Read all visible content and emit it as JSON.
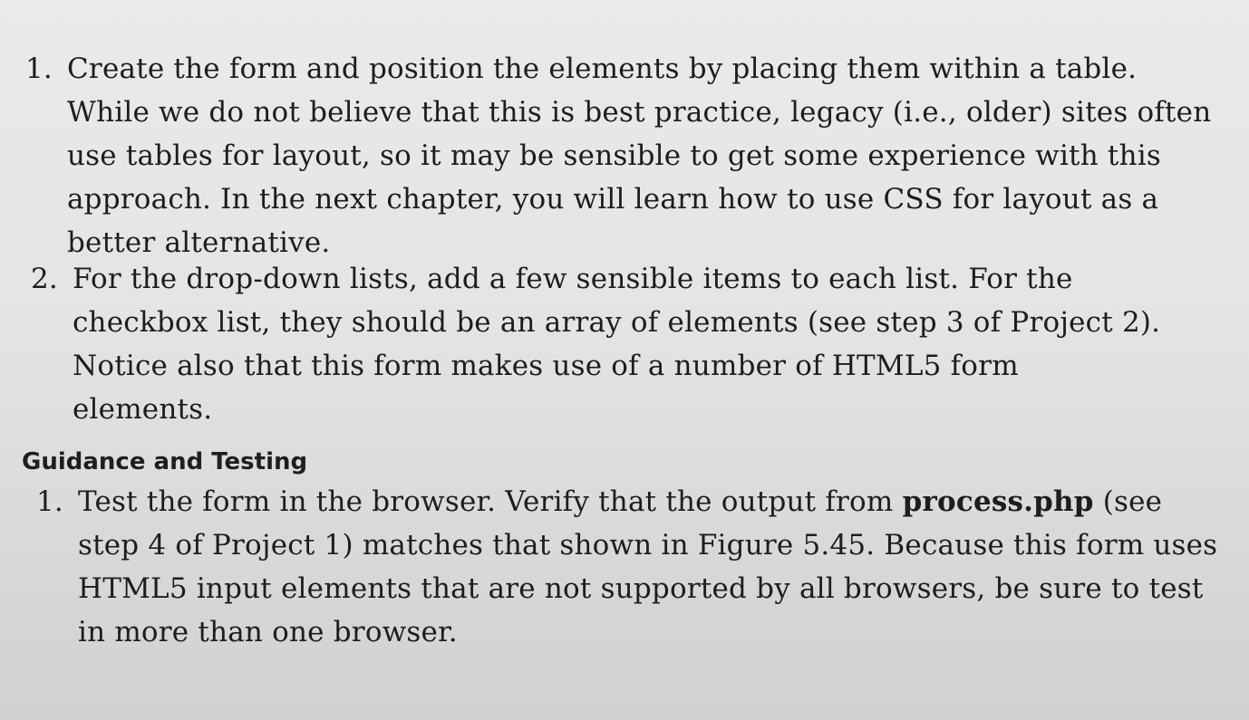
{
  "project_steps": [
    {
      "number": "1.",
      "lines": [
        "Create the form and position the elements by placing them within a table.",
        "While we do not believe that this is best practice, legacy (i.e., older) sites often",
        "use tables for layout, so it may be sensible to get some experience with this",
        "approach. In the next chapter, you will learn how to use CSS for layout as a",
        "better alternative."
      ]
    },
    {
      "number": "2.",
      "lines": [
        "For the drop-down lists, add a few sensible items to each list. For the",
        "checkbox list, they should be an array of elements (see step 3 of Project 2).",
        "Notice also that this form makes use of a number of HTML5 form",
        "elements."
      ]
    }
  ],
  "guidance": {
    "heading": "Guidance and Testing",
    "steps": [
      {
        "number": "1.",
        "line1_before": "Test the form in the browser. Verify that the output from ",
        "line1_bold": "process.php",
        "line1_after": " (see",
        "lines": [
          "step 4 of Project 1) matches that shown in Figure 5.45. Because this form uses",
          "HTML5 input elements that are not supported by all browsers, be sure to test",
          "in more than one browser."
        ]
      }
    ]
  }
}
